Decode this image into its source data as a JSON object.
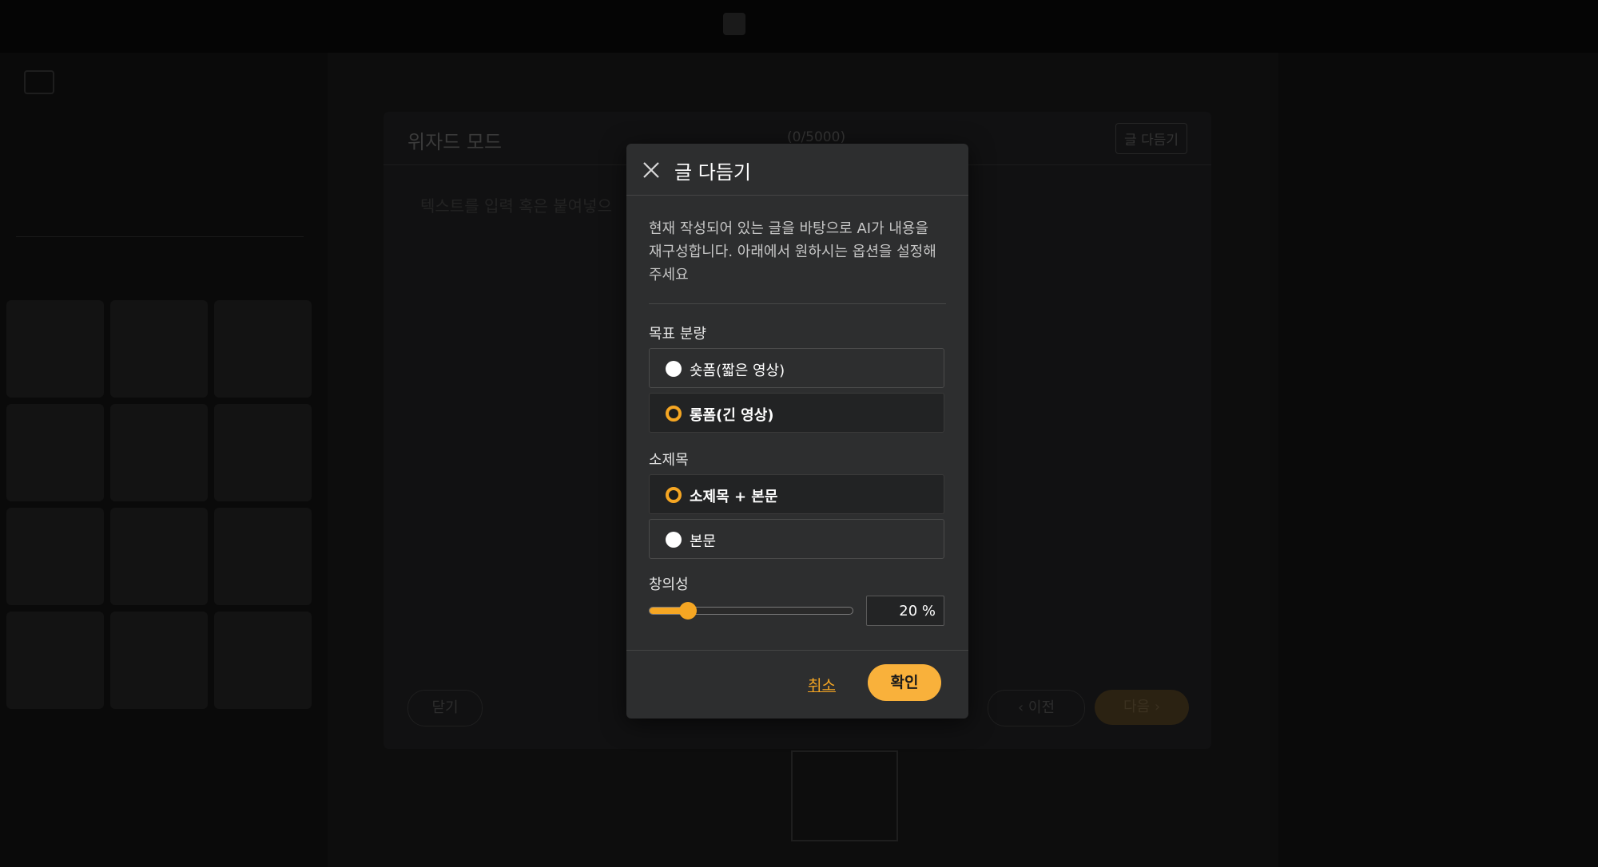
{
  "modal": {
    "title": "글 다듬기",
    "description": "현재 작성되어 있는 글을 바탕으로 AI가 내용을 재구성합니다. 아래에서 원하시는 옵션을 설정해 주세요",
    "length_label": "목표 분량",
    "length_options": [
      {
        "label": "숏폼(짧은 영상)",
        "selected": false
      },
      {
        "label": "롱폼(긴 영상)",
        "selected": true
      }
    ],
    "subtitle_label": "소제목",
    "subtitle_options": [
      {
        "label": "소제목 + 본문",
        "selected": true
      },
      {
        "label": "본문",
        "selected": false
      }
    ],
    "creativity_label": "창의성",
    "creativity_value": 20,
    "creativity_display": "20 %",
    "cancel_label": "취소",
    "confirm_label": "확인"
  },
  "wizard": {
    "title": "위자드 모드",
    "char_count": "(0/5000)",
    "tidy_button": "글 다듬기",
    "placeholder": "텍스트를 입력 혹은 붙여넣으",
    "close_label": "닫기",
    "prev_label": "이전",
    "next_label": "다음"
  },
  "colors": {
    "accent": "#f5a623",
    "modal_bg": "#2d2e2f",
    "backdrop": "#000000"
  }
}
